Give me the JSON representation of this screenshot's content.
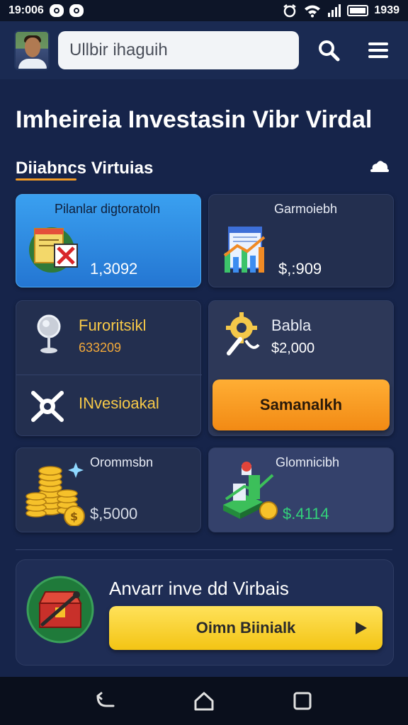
{
  "status_bar": {
    "time": "19:006",
    "clock_right": "1939"
  },
  "header": {
    "search_placeholder": "Ullbir ihaguih"
  },
  "page": {
    "title": "Imheireia Investasin Vibr Virdal"
  },
  "section": {
    "title": "Diiabncs Virtuias"
  },
  "cards": [
    {
      "label": "Pilanlar digtoratoln",
      "value": "1,3092",
      "icon": "document-reject-icon"
    },
    {
      "label": "Garmoiebh",
      "value": "$,:909",
      "icon": "bar-chart-icon"
    },
    {
      "label": "Furoritsikl",
      "value": "633209",
      "icon": "magnifier-stand-icon"
    },
    {
      "label": "Babla",
      "value": "$2,000",
      "icon": "gear-wrench-icon"
    },
    {
      "label": "INvesioakal",
      "icon": "crossed-tools-icon"
    },
    {
      "label": "Orommsbn",
      "value": "$,5000",
      "icon": "coin-stack-icon"
    },
    {
      "label": "Glomnicibh",
      "value": "$.4114",
      "icon": "growth-blocks-icon"
    }
  ],
  "orange_button": {
    "label": "Samanalkh"
  },
  "promo": {
    "title": "Anvarr inve dd Virbais",
    "button_label": "Oimn Biinialk",
    "icon": "treasure-chest-icon"
  },
  "colors": {
    "background": "#16244a",
    "card": "#232f4f",
    "card_highlight": "#2e8be0",
    "orange": "#f28a14",
    "yellow": "#f3c414",
    "accent_value": "#f7c948",
    "green_value": "#33d17a"
  }
}
